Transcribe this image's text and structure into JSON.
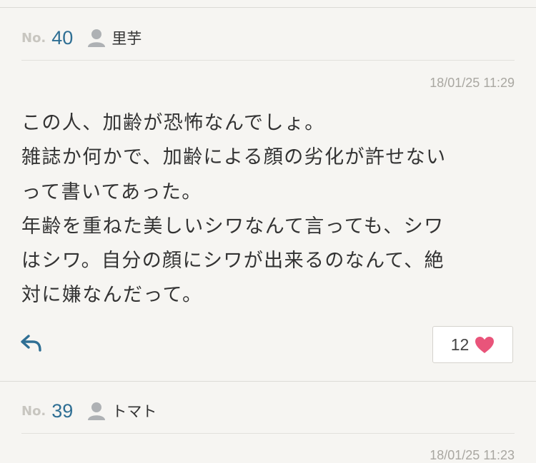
{
  "comments": [
    {
      "no_label": "No.",
      "number": "40",
      "user_icon": "user-icon",
      "username": "里芋",
      "timestamp": "18/01/25 11:29",
      "lines": [
        "この人、加齢が恐怖なんでしょ。",
        "雑誌か何かで、加齢による顔の劣化が許せない",
        "って書いてあった。",
        "年齢を重ねた美しいシワなんて言っても、シワ",
        "はシワ。自分の顔にシワが出来るのなんて、絶",
        "対に嫌なんだって。"
      ],
      "reply_icon": "reply-icon",
      "like_count": "12",
      "like_icon": "heart-icon"
    },
    {
      "no_label": "No.",
      "number": "39",
      "user_icon": "user-icon",
      "username": "トマト",
      "timestamp": "18/01/25 11:23"
    }
  ],
  "colors": {
    "background": "#f6f5f2",
    "number": "#2f6f94",
    "heart": "#e9547a",
    "reply": "#2f6f94",
    "muted": "#a9a7a1"
  }
}
